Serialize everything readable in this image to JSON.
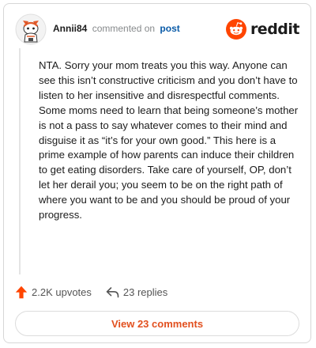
{
  "comment": {
    "username": "Annii84",
    "commented_on_text": "commented on",
    "post_link_label": "post",
    "body": "NTA. Sorry your mom treats you this way. Anyone can see this isn’t constructive criticism and you don’t have to listen to her insensitive and disrespectful comments. Some moms need to learn that being someone’s mother is not a pass to say whatever comes to their mind and disguise it as “it’s for your own good.” This here is a prime example of how parents can induce their children to get eating disorders. Take care of yourself, OP, don’t let her derail you; you seem to be on the right path of where you want to be and you should be proud of your progress."
  },
  "brand": {
    "name": "reddit",
    "icon": "reddit-snoo-icon",
    "color": "#ff4500"
  },
  "actions": {
    "upvotes_label": "2.2K upvotes",
    "upvote_icon": "upvote-arrow-icon",
    "upvote_color": "#ff4500",
    "replies_label": "23 replies",
    "reply_icon": "reply-arrow-icon"
  },
  "footer": {
    "view_comments_label": "View 23 comments",
    "accent_color": "#e2501f"
  }
}
